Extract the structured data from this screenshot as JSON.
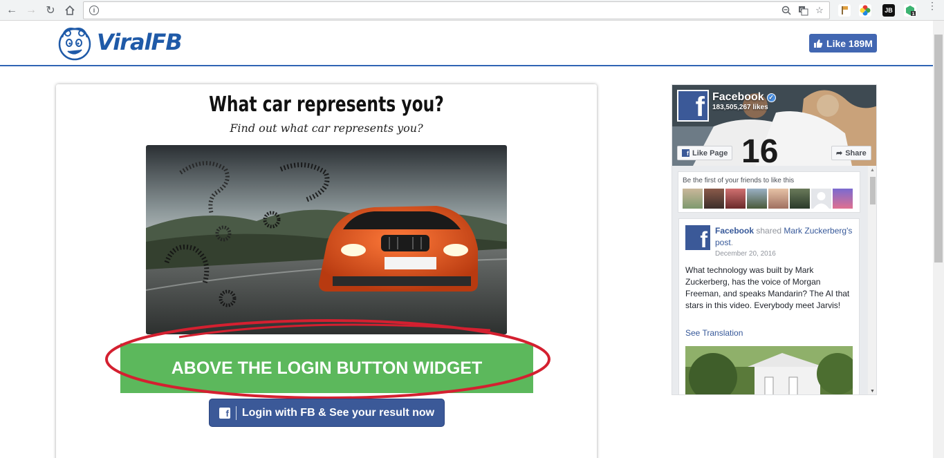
{
  "browser": {
    "address": "",
    "back_icon": "arrow-left",
    "forward_icon": "arrow-right",
    "reload_icon": "reload",
    "home_icon": "home",
    "ext_badge": "1"
  },
  "header": {
    "logo_text": "ViralFB",
    "like_label": "Like 189M"
  },
  "quiz": {
    "title": "What car represents you?",
    "subtitle": "Find out what car represents you?",
    "widget_text": "ABOVE THE LOGIN BUTTON WIDGET",
    "login_label": "Login with FB & See your result now",
    "accent_green": "#5cb85c",
    "accent_red": "#d42030",
    "fb_blue": "#3b5998"
  },
  "fb_widget": {
    "page_name": "Facebook",
    "likes": "183,505,267 likes",
    "like_page": "Like Page",
    "share": "Share",
    "friends_text": "Be the first of your friends to like this",
    "post": {
      "author": "Facebook",
      "verb": " shared ",
      "target": "Mark Zuckerberg",
      "possessive": "'s ",
      "object": "post",
      "end": ".",
      "date": "December 20, 2016",
      "text": "What technology was built by Mark Zuckerberg, has the voice of Morgan Freeman, and speaks Mandarin? The AI that stars in this video. Everybody meet Jarvis!",
      "see_translation": "See Translation"
    }
  }
}
